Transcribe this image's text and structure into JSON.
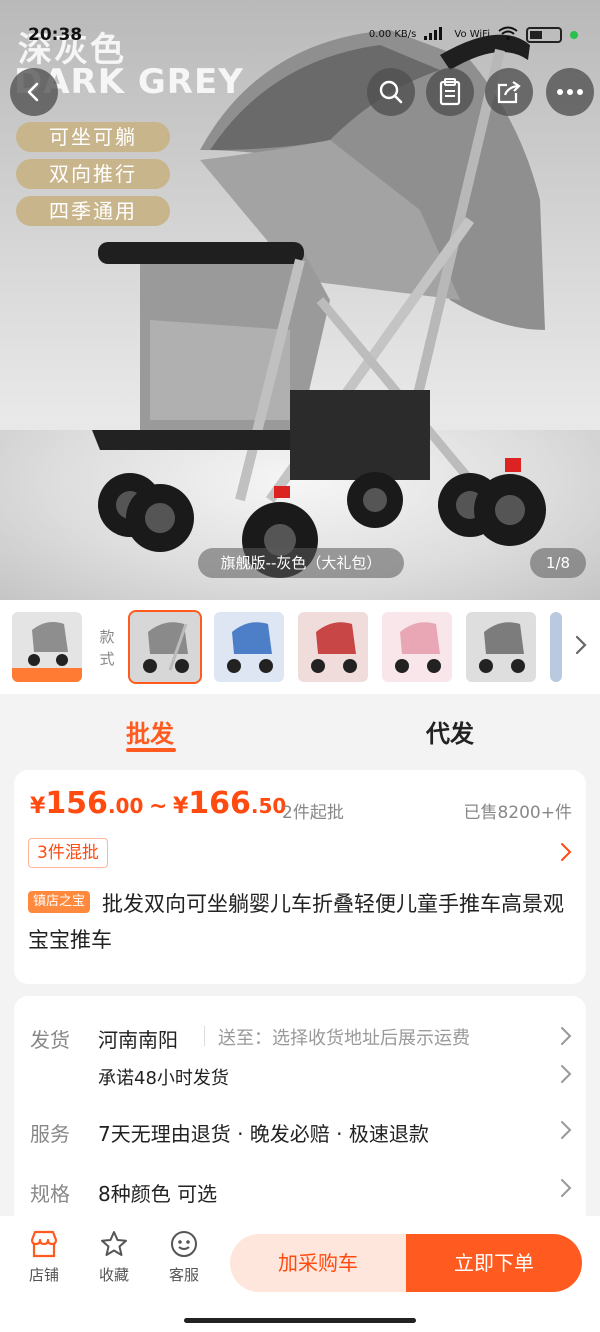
{
  "status_bar": {
    "time": "20:38",
    "net_speed": "0.00 KB/s",
    "signal": "Vo WiFi"
  },
  "hero": {
    "watermark_cn": "深灰色",
    "watermark_en": "DARK GREY",
    "feature_tags": [
      "可坐可躺",
      "双向推行",
      "四季通用"
    ],
    "caption": "旗舰版--灰色（大礼包）",
    "counter": "1/8"
  },
  "nav": {
    "back_icon": "chevron-left-icon",
    "search_icon": "search-icon",
    "clipboard_icon": "clipboard-icon",
    "share_icon": "share-icon",
    "more_icon": "more-icon"
  },
  "thumbnails": {
    "style_label": "款式",
    "items": [
      {
        "color": "#9c9c9c"
      },
      {
        "color": "#8a8a8a"
      },
      {
        "color": "#4d7fc8"
      },
      {
        "color": "#c84646"
      },
      {
        "color": "#e9a7b6"
      },
      {
        "color": "#7c7c7c"
      },
      {
        "color": "#b8c9e0"
      }
    ]
  },
  "tabs": [
    {
      "label": "批发",
      "active": true
    },
    {
      "label": "代发",
      "active": false
    }
  ],
  "price": {
    "currency": "¥",
    "low_int": "156",
    "low_dec": ".00",
    "separator": "~",
    "high_int": "166",
    "high_dec": ".50",
    "min_batch": "2件起批",
    "sold": "已售8200+件",
    "mix_tag": "3件混批",
    "shop_badge": "镇店之宝",
    "title": "批发双向可坐躺婴儿车折叠轻便儿童手推车高景观宝宝推车"
  },
  "info": {
    "ship_label": "发货",
    "ship_from": "河南南阳",
    "ship_to": "送至：选择收货地址后展示运费",
    "ship_promise": "承诺48小时发货",
    "service_label": "服务",
    "service_text": "7天无理由退货 · 晚发必赔 · 极速退款",
    "spec_label": "规格",
    "spec_text": "8种颜色 可选"
  },
  "bottom_bar": {
    "shop_label": "店铺",
    "fav_label": "收藏",
    "service_label": "客服",
    "cart_button": "加采购车",
    "buy_button": "立即下单"
  },
  "colors": {
    "accent": "#ff5a1f",
    "price": "#ff4a10",
    "tag_gold": "#c9b58b"
  }
}
